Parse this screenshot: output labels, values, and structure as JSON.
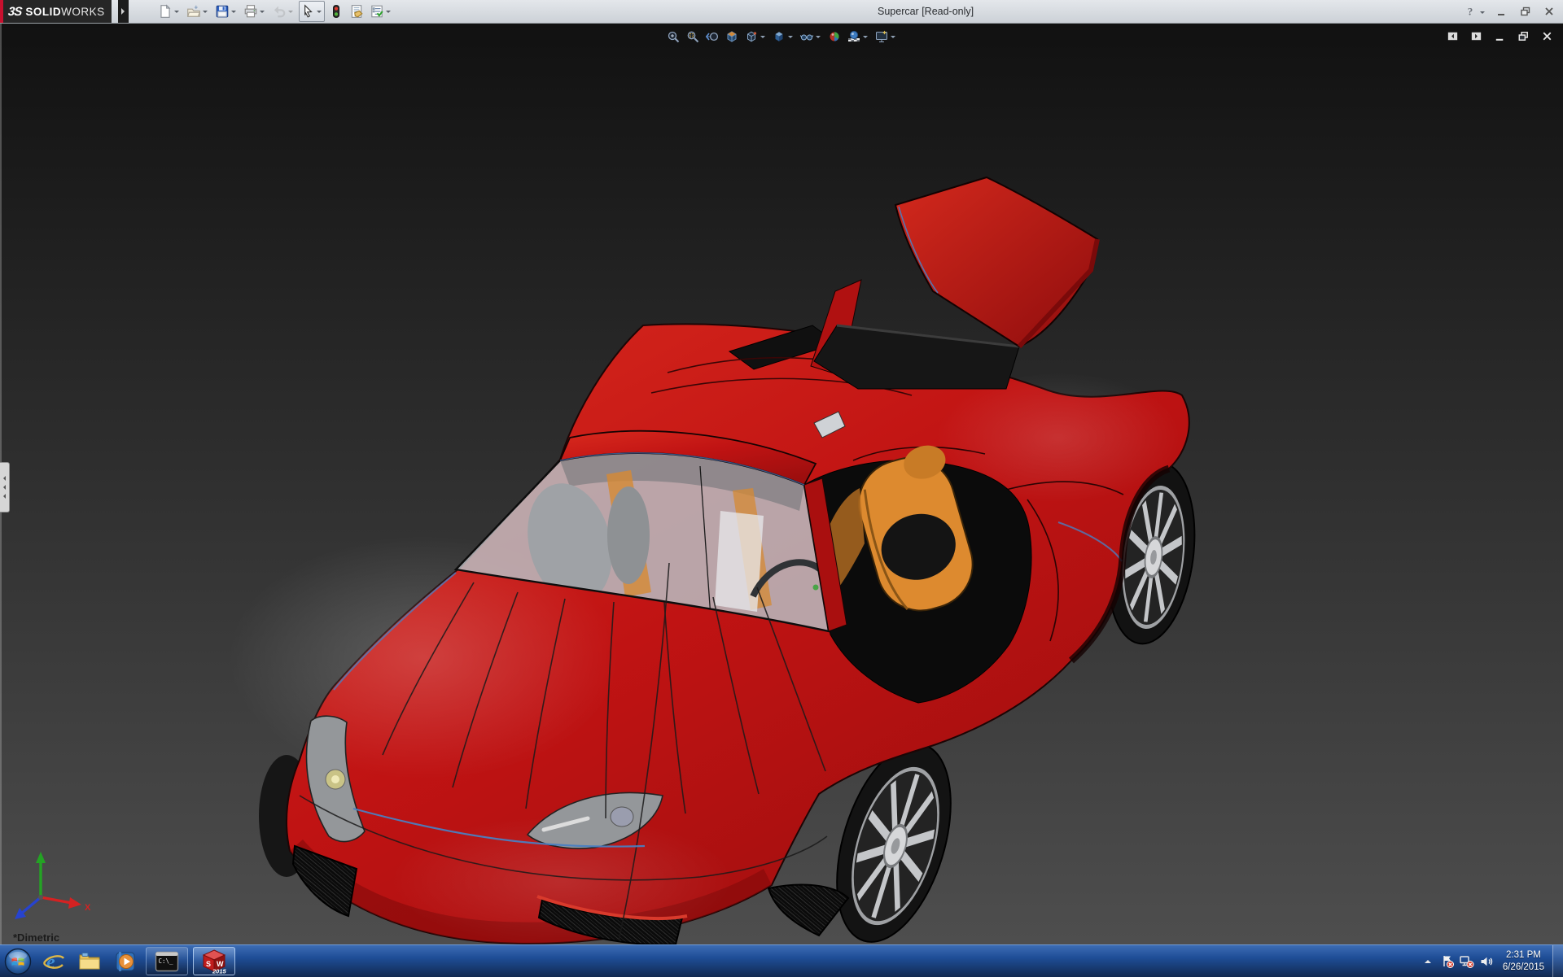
{
  "titlebar": {
    "brand_mark": "3S",
    "brand_primary": "SOLID",
    "brand_secondary": "WORKS",
    "title": "Supercar [Read-only]",
    "tools": [
      {
        "name": "new-document",
        "icon": "new-document",
        "dropdown": true
      },
      {
        "name": "open",
        "icon": "open",
        "dropdown": true
      },
      {
        "name": "save",
        "icon": "save",
        "dropdown": true
      },
      {
        "name": "print",
        "icon": "print",
        "dropdown": true
      },
      {
        "name": "undo",
        "icon": "undo",
        "dropdown": true,
        "disabled": true
      },
      {
        "name": "select",
        "icon": "select",
        "dropdown": true,
        "pressed": true
      },
      {
        "name": "rebuild",
        "icon": "rebuild",
        "dropdown": false
      },
      {
        "name": "file-properties",
        "icon": "file-properties",
        "dropdown": false
      },
      {
        "name": "options",
        "icon": "options",
        "dropdown": true
      }
    ],
    "window_controls": [
      {
        "name": "help",
        "icon": "help",
        "dropdown": true
      },
      {
        "name": "minimize",
        "icon": "minimize"
      },
      {
        "name": "restore",
        "icon": "restore"
      },
      {
        "name": "close",
        "icon": "close"
      }
    ]
  },
  "viewport": {
    "headsup_tools": [
      {
        "name": "zoom-to-fit",
        "icon": "zoom-to-fit"
      },
      {
        "name": "zoom-to-area",
        "icon": "zoom-to-area"
      },
      {
        "name": "previous-view",
        "icon": "previous-view"
      },
      {
        "name": "section-view",
        "icon": "section-view"
      },
      {
        "name": "view-orientation",
        "icon": "view-orientation",
        "dropdown": true
      },
      {
        "name": "display-style",
        "icon": "display-style",
        "dropdown": true
      },
      {
        "name": "hide-show-items",
        "icon": "hide-show-items",
        "dropdown": true
      },
      {
        "name": "edit-appearance",
        "icon": "edit-appearance"
      },
      {
        "name": "apply-scene",
        "icon": "apply-scene",
        "dropdown": true
      },
      {
        "name": "view-settings",
        "icon": "view-settings",
        "dropdown": true
      }
    ],
    "document_controls": [
      {
        "name": "collapse-left-pane",
        "icon": "pane-left"
      },
      {
        "name": "collapse-right-pane",
        "icon": "pane-right"
      },
      {
        "name": "document-minimize",
        "icon": "doc-minimize"
      },
      {
        "name": "document-restore",
        "icon": "doc-restore"
      },
      {
        "name": "document-close",
        "icon": "doc-close"
      }
    ],
    "orientation_label": "*Dimetric",
    "triad": {
      "x_label": "X"
    },
    "model": {
      "name": "Supercar",
      "view": "dimetric",
      "display_style": "shaded-with-edges"
    }
  },
  "taskbar": {
    "items": [
      {
        "name": "start"
      },
      {
        "name": "internet-explorer"
      },
      {
        "name": "windows-explorer"
      },
      {
        "name": "media-player"
      },
      {
        "name": "command-prompt",
        "open": true
      },
      {
        "name": "solidworks-2015",
        "open": true,
        "active": true
      }
    ],
    "cmd_label": "C:\\_",
    "sw_front": "S",
    "sw_side": "W",
    "sw_badge": "2015",
    "tray": {
      "icons": [
        "hidden-icons",
        "action-center",
        "network-disconnected",
        "volume"
      ],
      "time": "2:31 PM",
      "date": "6/26/2015"
    }
  },
  "theme": {
    "colors": {
      "titlebar_bg1": "#e4e7eb",
      "titlebar_bg2": "#ccd1d7",
      "logo_bg": "#262626",
      "brand_red": "#c8102e",
      "viewport_top": "#111111",
      "viewport_bottom": "#4e4e4e",
      "body_red": "#c41414",
      "body_red_dark": "#8a0d0d",
      "accent_blue": "#4a7ec0",
      "seat_orange": "#dd8a2f",
      "glass_gray": "#b9bdc2",
      "rim_silver": "#c8cacd",
      "tire_black": "#141414",
      "taskbar_top": "#3c6cb4",
      "taskbar_mid": "#1e4d96",
      "taskbar_bottom": "#12294f",
      "tray_text": "#ffffff"
    }
  }
}
